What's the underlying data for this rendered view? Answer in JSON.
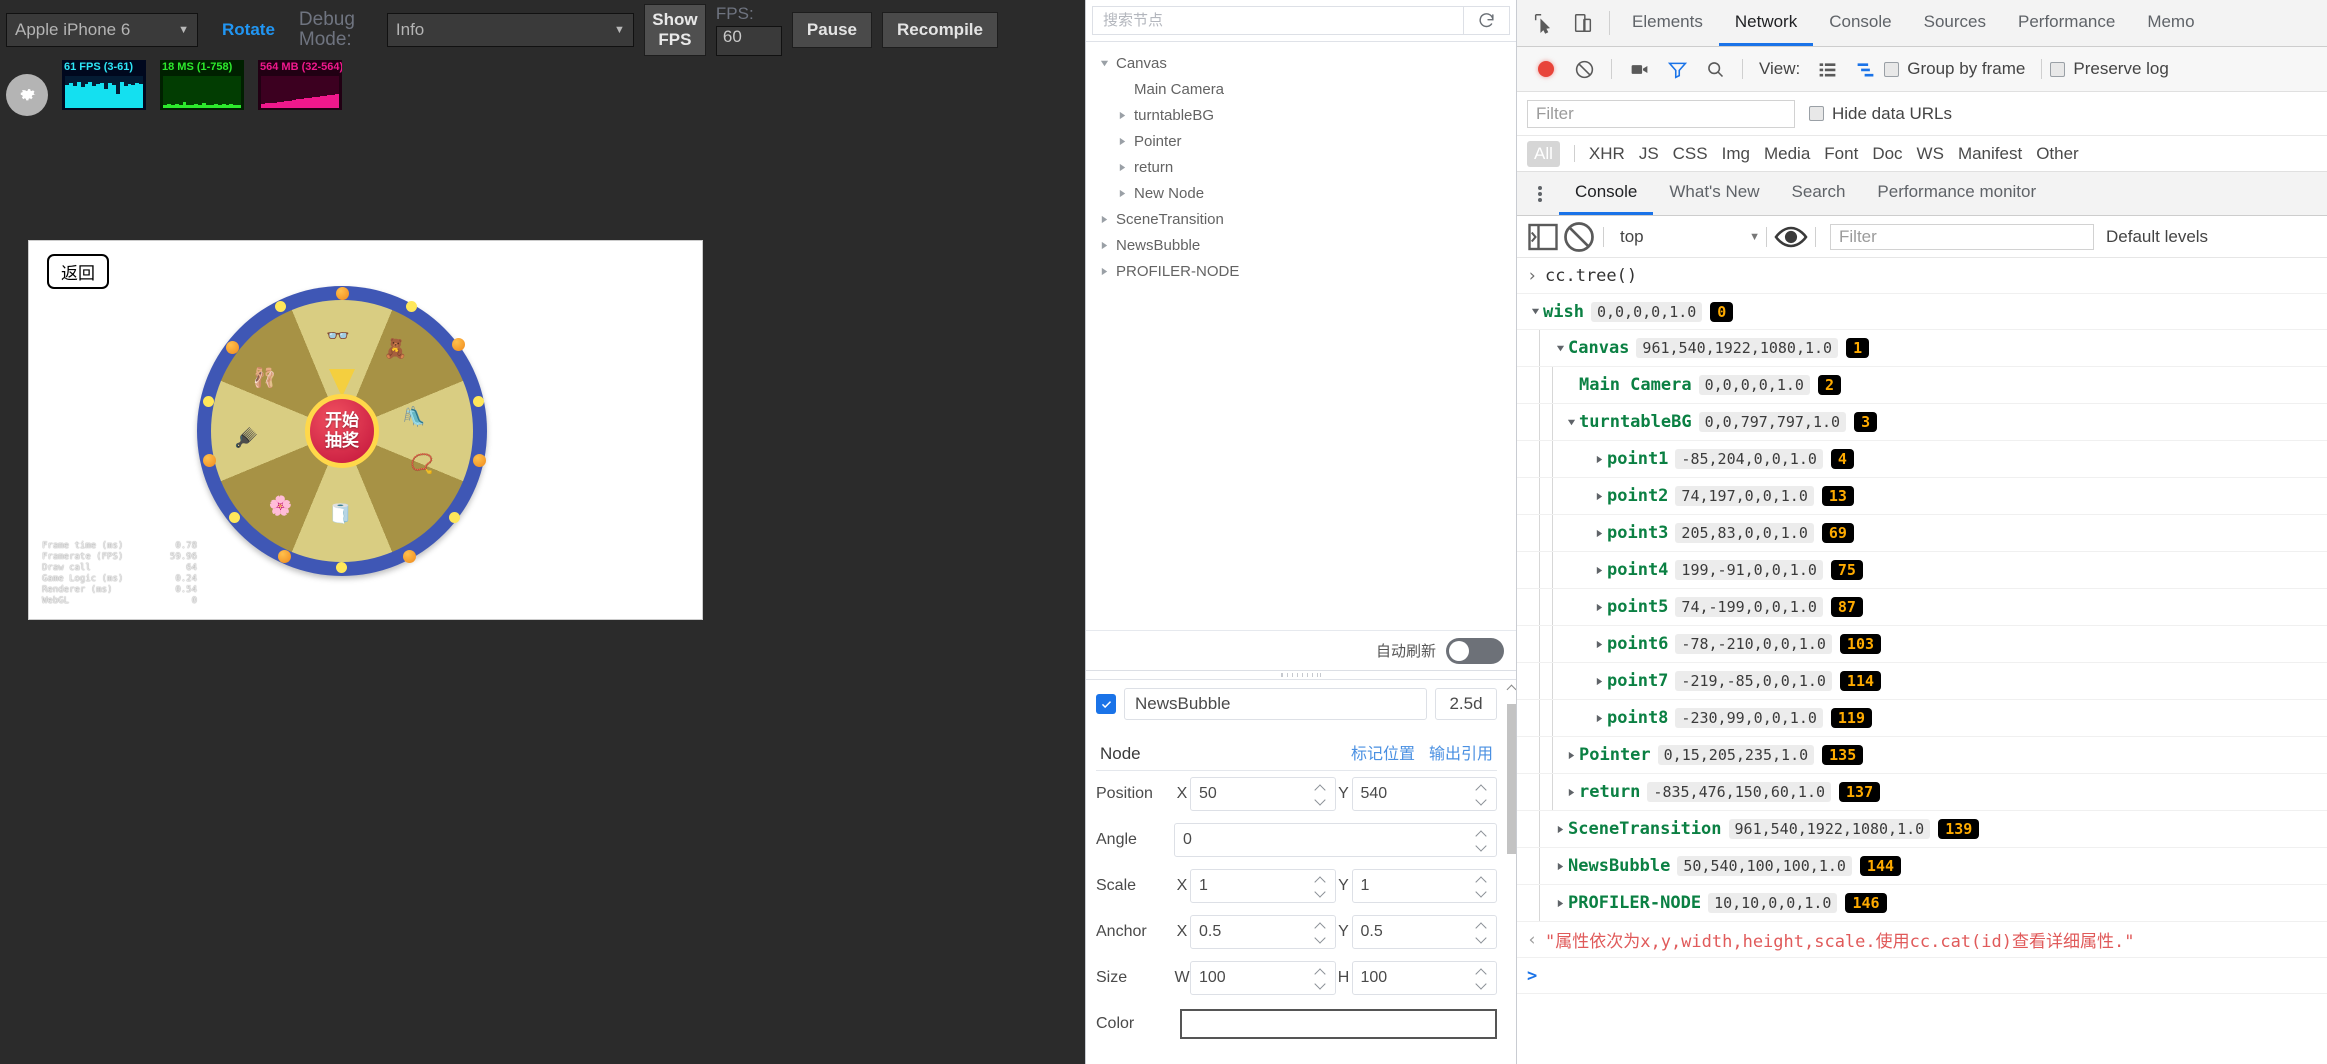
{
  "simulator": {
    "device_select": {
      "value": "Apple iPhone 6",
      "caret": "▼"
    },
    "rotate_button": "Rotate",
    "debug_mode_label_1": "Debug",
    "debug_mode_label_2": "Mode:",
    "mode_select": {
      "value": "Info",
      "caret": "▼"
    },
    "show_fps_button_1": "Show",
    "show_fps_button_2": "FPS",
    "fps_label": "FPS:",
    "fps_value": "60",
    "pause_button": "Pause",
    "recompile_button": "Recompile",
    "stats": [
      {
        "name": "fps-graph",
        "label": "61 FPS (3-61)"
      },
      {
        "name": "ms-graph",
        "label": "18 MS (1-758)"
      },
      {
        "name": "mb-graph",
        "label": "564 MB (32-564)"
      }
    ],
    "game": {
      "return_button": "返回",
      "wheel_center_line1": "开始",
      "wheel_center_line2": "抽奖",
      "profiler": [
        {
          "key": "Frame time (ms)",
          "value": "0.78"
        },
        {
          "key": "Framerate (FPS)",
          "value": "59.96"
        },
        {
          "key": "Draw call",
          "value": "64"
        },
        {
          "key": "Game Logic (ms)",
          "value": "0.24"
        },
        {
          "key": "Renderer (ms)",
          "value": "0.54"
        },
        {
          "key": "WebGL",
          "value": "0"
        }
      ],
      "prizes": [
        "👓",
        "🧸",
        "🩰",
        "🛝",
        "📿",
        "🪮",
        "🌸",
        "🧻"
      ]
    }
  },
  "inspector": {
    "search_placeholder": "搜索节点",
    "refresh_icon": "refresh-icon",
    "tree": [
      {
        "label": "Canvas",
        "depth": 0,
        "twisty": "open"
      },
      {
        "label": "Main Camera",
        "depth": 1,
        "twisty": "none"
      },
      {
        "label": "turntableBG",
        "depth": 1,
        "twisty": "closed"
      },
      {
        "label": "Pointer",
        "depth": 1,
        "twisty": "closed"
      },
      {
        "label": "return",
        "depth": 1,
        "twisty": "closed"
      },
      {
        "label": "New Node",
        "depth": 1,
        "twisty": "closed"
      },
      {
        "label": "SceneTransition",
        "depth": 0,
        "twisty": "closed"
      },
      {
        "label": "NewsBubble",
        "depth": 0,
        "twisty": "closed"
      },
      {
        "label": "PROFILER-NODE",
        "depth": 0,
        "twisty": "closed"
      }
    ],
    "auto_refresh_label": "自动刷新",
    "selected_node_name": "NewsBubble",
    "mode_badge": "2.5d",
    "section_title": "Node",
    "link_mark_position": "标记位置",
    "link_output_ref": "输出引用",
    "properties": [
      {
        "label": "Position",
        "a1": "X",
        "v1": "50",
        "a2": "Y",
        "v2": "540"
      },
      {
        "label": "Angle",
        "a1": "",
        "v1": "0",
        "a2": "",
        "v2": null
      },
      {
        "label": "Scale",
        "a1": "X",
        "v1": "1",
        "a2": "Y",
        "v2": "1"
      },
      {
        "label": "Anchor",
        "a1": "X",
        "v1": "0.5",
        "a2": "Y",
        "v2": "0.5"
      },
      {
        "label": "Size",
        "a1": "W",
        "v1": "100",
        "a2": "H",
        "v2": "100"
      }
    ],
    "color_label": "Color",
    "color_value": "#FFFFFF"
  },
  "devtools": {
    "tabs": [
      {
        "label": "Elements",
        "active": false
      },
      {
        "label": "Network",
        "active": true
      },
      {
        "label": "Console",
        "active": false
      },
      {
        "label": "Sources",
        "active": false
      },
      {
        "label": "Performance",
        "active": false
      },
      {
        "label": "Memo",
        "active": false
      }
    ],
    "network": {
      "record_icon": "record-icon",
      "clear_icon": "clear-icon",
      "camera_icon": "camera-icon",
      "filter_icon": "funnel-icon",
      "search_icon": "search-icon",
      "view_label": "View:",
      "view_list_icon": "list-view-icon",
      "view_waterfall_icon": "waterfall-view-icon",
      "group_by_frame": "Group by frame",
      "preserve_log": "Preserve log",
      "filter_placeholder": "Filter",
      "hide_data_urls": "Hide data URLs",
      "types": [
        "All",
        "XHR",
        "JS",
        "CSS",
        "Img",
        "Media",
        "Font",
        "Doc",
        "WS",
        "Manifest",
        "Other"
      ]
    },
    "drawer": {
      "tabs": [
        {
          "label": "Console",
          "active": true
        },
        {
          "label": "What's New",
          "active": false
        },
        {
          "label": "Search",
          "active": false
        },
        {
          "label": "Performance monitor",
          "active": false
        }
      ],
      "sidebar_icon": "console-sidebar-icon",
      "clear_icon": "clear-console-icon",
      "context": "top",
      "context_caret": "▼",
      "eye_icon": "live-expression-icon",
      "filter_placeholder": "Filter",
      "levels": "Default levels"
    },
    "console_output": {
      "command": "cc.tree()",
      "rows": [
        {
          "name": "wish",
          "attrs": "0,0,0,0,1.0",
          "id": "0",
          "depth": 0,
          "twisty": "open"
        },
        {
          "name": "Canvas",
          "attrs": "961,540,1922,1080,1.0",
          "id": "1",
          "depth": 1,
          "twisty": "open"
        },
        {
          "name": "Main Camera",
          "attrs": "0,0,0,0,1.0",
          "id": "2",
          "depth": 2,
          "twisty": "none"
        },
        {
          "name": "turntableBG",
          "attrs": "0,0,797,797,1.0",
          "id": "3",
          "depth": 2,
          "twisty": "open"
        },
        {
          "name": "point1",
          "attrs": "-85,204,0,0,1.0",
          "id": "4",
          "depth": 3,
          "twisty": "closed"
        },
        {
          "name": "point2",
          "attrs": "74,197,0,0,1.0",
          "id": "13",
          "depth": 3,
          "twisty": "closed"
        },
        {
          "name": "point3",
          "attrs": "205,83,0,0,1.0",
          "id": "69",
          "depth": 3,
          "twisty": "closed"
        },
        {
          "name": "point4",
          "attrs": "199,-91,0,0,1.0",
          "id": "75",
          "depth": 3,
          "twisty": "closed"
        },
        {
          "name": "point5",
          "attrs": "74,-199,0,0,1.0",
          "id": "87",
          "depth": 3,
          "twisty": "closed"
        },
        {
          "name": "point6",
          "attrs": "-78,-210,0,0,1.0",
          "id": "103",
          "depth": 3,
          "twisty": "closed"
        },
        {
          "name": "point7",
          "attrs": "-219,-85,0,0,1.0",
          "id": "114",
          "depth": 3,
          "twisty": "closed"
        },
        {
          "name": "point8",
          "attrs": "-230,99,0,0,1.0",
          "id": "119",
          "depth": 3,
          "twisty": "closed"
        },
        {
          "name": "Pointer",
          "attrs": "0,15,205,235,1.0",
          "id": "135",
          "depth": 2,
          "twisty": "closed"
        },
        {
          "name": "return",
          "attrs": "-835,476,150,60,1.0",
          "id": "137",
          "depth": 2,
          "twisty": "closed"
        },
        {
          "name": "SceneTransition",
          "attrs": "961,540,1922,1080,1.0",
          "id": "139",
          "depth": 1,
          "twisty": "closed"
        },
        {
          "name": "NewsBubble",
          "attrs": "50,540,100,100,1.0",
          "id": "144",
          "depth": 1,
          "twisty": "closed"
        },
        {
          "name": "PROFILER-NODE",
          "attrs": "10,10,0,0,1.0",
          "id": "146",
          "depth": 1,
          "twisty": "closed"
        }
      ],
      "result_message": "\"属性依次为x,y,width,height,scale.使用cc.cat(id)查看详细属性.\"",
      "prompt": ">"
    }
  },
  "colors": {
    "accent_blue": "#1a73e8",
    "console_node_green": "#0b8043",
    "badge_amber": "#ffab00",
    "record_red": "#e8443a",
    "error_red": "#e05a5a",
    "wheel_ring": "#3f57b5",
    "wheel_light": "#d9cd82",
    "wheel_dark": "#a79245",
    "hub_red": "#c2133b"
  }
}
